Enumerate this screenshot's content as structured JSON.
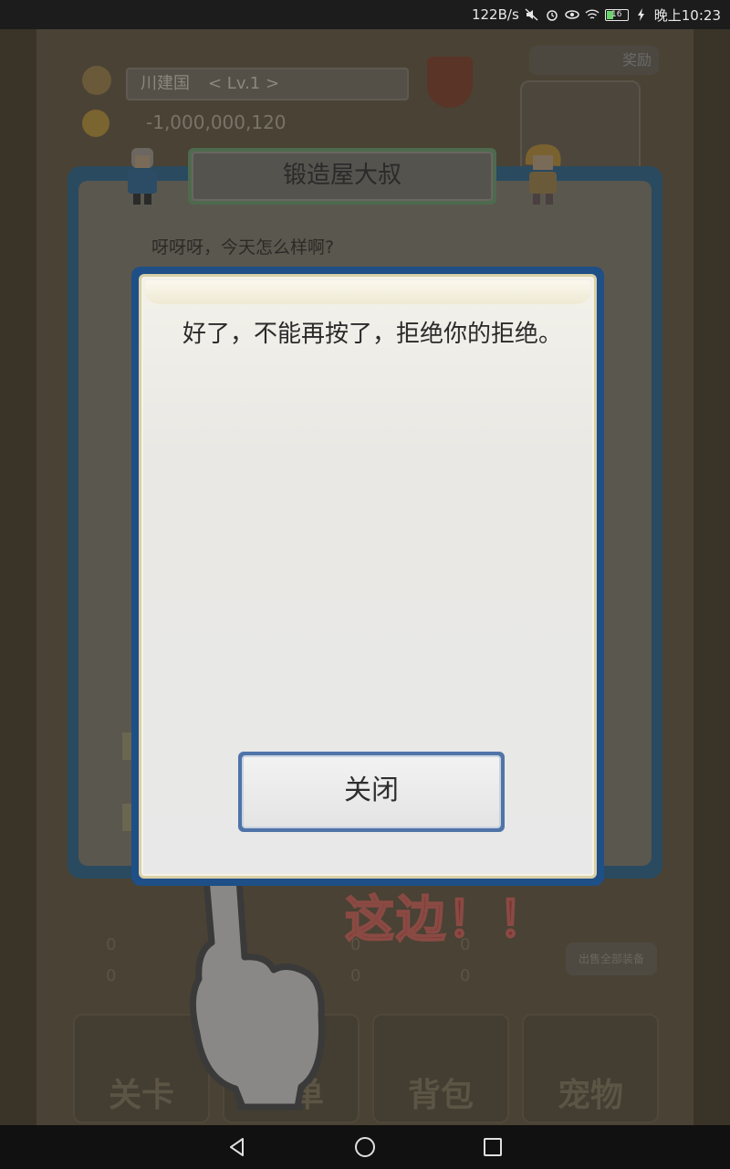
{
  "status_bar": {
    "net_speed": "122B/s",
    "battery_level": "16",
    "time": "晚上10:23"
  },
  "game": {
    "country_name": "川建国",
    "level": "< Lv.1 >",
    "gold": "-1,000,000,120",
    "top_badge": "奖励",
    "back_dialog": {
      "npc_name": "锻造屋大叔",
      "greeting": "呀呀呀，今天怎么样啊?"
    },
    "hint_text": "这边！！",
    "bottom_stats": [
      "0",
      "0",
      "0",
      "0",
      "0",
      "0"
    ],
    "sell_all": "出售全部装备",
    "nav_tabs": [
      "关卡",
      "菜单",
      "背包",
      "宠物"
    ]
  },
  "modal": {
    "message": "好了，不能再按了，拒绝你的拒绝。",
    "close_label": "关闭"
  },
  "colors": {
    "modal_border": "#1e4f86",
    "button_border": "#4f74a8",
    "hint_text": "#7a3230"
  }
}
